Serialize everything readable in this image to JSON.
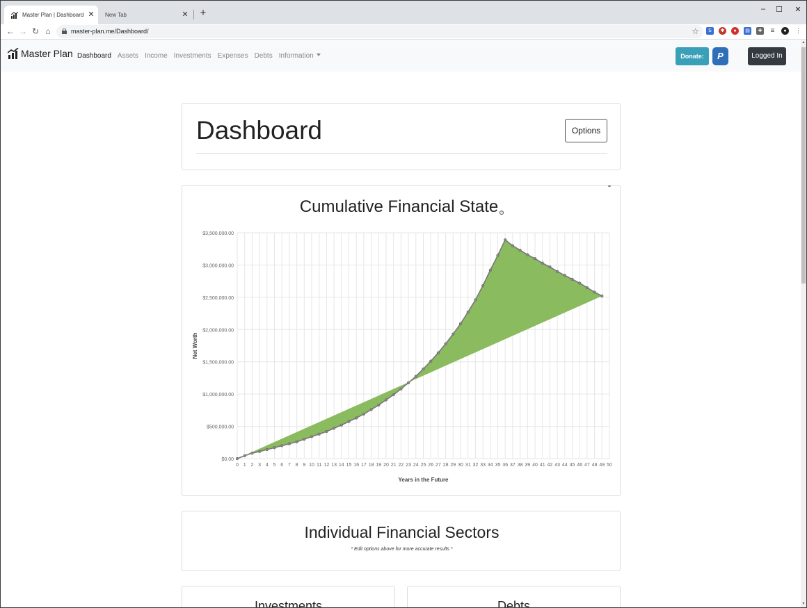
{
  "browser": {
    "tabs": [
      {
        "title": "Master Plan | Dashboard",
        "active": true
      },
      {
        "title": "New Tab",
        "active": false
      }
    ],
    "url": "master-plan.me/Dashboard/"
  },
  "navbar": {
    "brand": "Master Plan",
    "links": [
      "Dashboard",
      "Assets",
      "Income",
      "Investments",
      "Expenses",
      "Debts",
      "Information"
    ],
    "active_link": "Dashboard",
    "donate_label": "Donate:",
    "paypal_label": "P",
    "logged_in_label": "Logged In"
  },
  "dashboard": {
    "title": "Dashboard",
    "options_label": "Options"
  },
  "chart_section": {
    "title": "Cumulative Financial State",
    "info_glyph": "i"
  },
  "chart_data": {
    "type": "area",
    "title": "Cumulative Financial State",
    "xlabel": "Years in the Future",
    "ylabel": "Net Worth",
    "x": [
      0,
      1,
      2,
      3,
      4,
      5,
      6,
      7,
      8,
      9,
      10,
      11,
      12,
      13,
      14,
      15,
      16,
      17,
      18,
      19,
      20,
      21,
      22,
      23,
      24,
      25,
      26,
      27,
      28,
      29,
      30,
      31,
      32,
      33,
      34,
      35,
      36,
      37,
      38,
      39,
      40,
      41,
      42,
      43,
      44,
      45,
      46,
      47,
      48,
      49,
      50
    ],
    "yticks": [
      "$0.00",
      "$500,000.00",
      "$1,000,000.00",
      "$1,500,000.00",
      "$2,000,000.00",
      "$2,500,000.00",
      "$3,000,000.00",
      "$3,500,000.00"
    ],
    "ylim": [
      0,
      3500000
    ],
    "series": [
      {
        "values": [
          0,
          45000,
          85000,
          110000,
          140000,
          170000,
          200000,
          230000,
          260000,
          300000,
          340000,
          380000,
          420000,
          470000,
          520000,
          575000,
          630000,
          690000,
          760000,
          830000,
          910000,
          990000,
          1080000,
          1175000,
          1275000,
          1390000,
          1510000,
          1640000,
          1780000,
          1930000,
          2090000,
          2270000,
          2460000,
          2680000,
          2920000,
          3150000,
          3390000,
          3300000,
          3230000,
          3160000,
          3100000,
          3030000,
          2970000,
          2900000,
          2840000,
          2780000,
          2720000,
          2650000,
          2580000,
          2520000
        ],
        "fill": "#8bbb5f",
        "stroke": "#777777"
      }
    ],
    "grid": true,
    "legend": "none"
  },
  "sectors": {
    "title": "Individual Financial Sectors",
    "subtitle": "* Edit options above for more accurate results *"
  },
  "subcards": {
    "left_title": "Investments",
    "right_title": "Debts"
  },
  "colors": {
    "donate": "#3aa0b8",
    "paypal": "#2f6fb7",
    "logged_in": "#343a40",
    "area_fill": "#8bbb5f"
  }
}
